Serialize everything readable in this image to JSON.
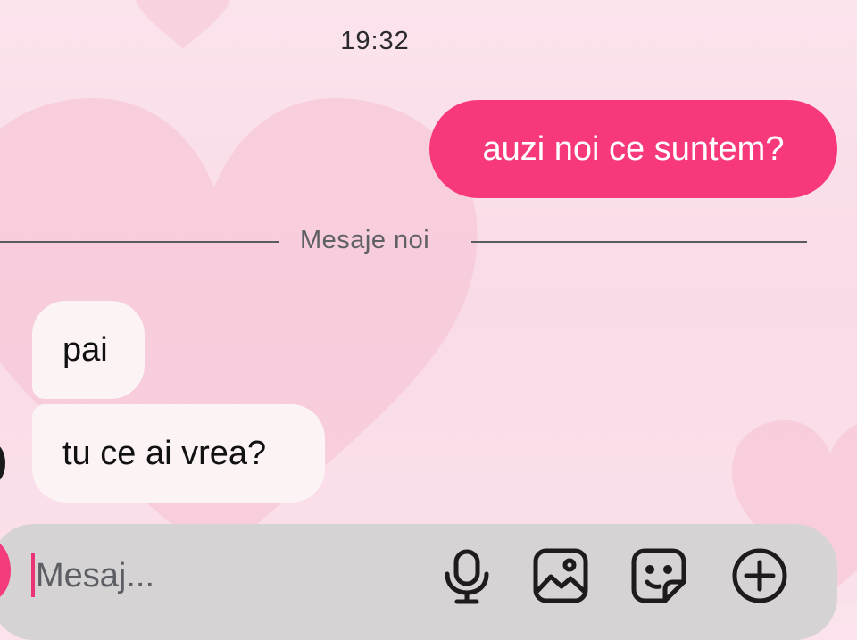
{
  "header": {
    "time": "19:32"
  },
  "messages": {
    "outgoing": [
      {
        "text": "auzi noi ce suntem?"
      }
    ],
    "divider_label": "Mesaje noi",
    "incoming": [
      {
        "text": "pai"
      },
      {
        "text": "tu ce ai vrea?"
      }
    ]
  },
  "composer": {
    "placeholder": "Mesaj...",
    "icons": [
      "camera-button",
      "microphone-icon",
      "gallery-icon",
      "sticker-icon",
      "plus-circle-icon"
    ]
  },
  "colors": {
    "accent": "#f7397c",
    "background": "#fbe3ec",
    "incoming_bubble": "#fcf3f5",
    "composer": "#d5d3d4"
  }
}
